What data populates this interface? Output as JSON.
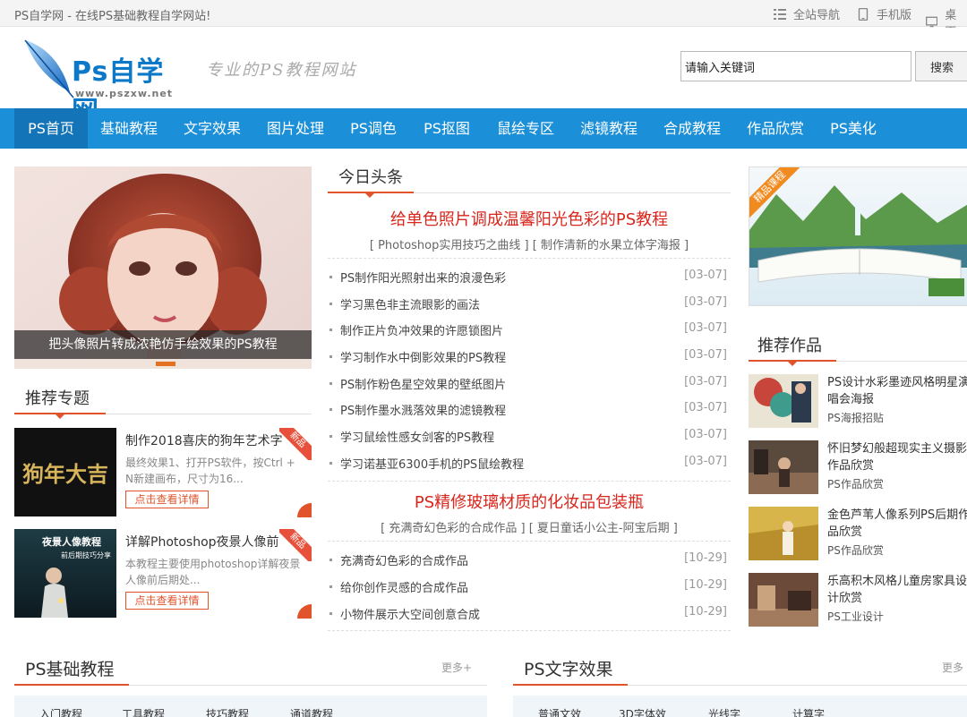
{
  "topbar": {
    "note": "PS自学网 - 在线PS基础教程自学网站!",
    "links": [
      {
        "label": "全站导航",
        "icon": "list-icon"
      },
      {
        "label": "手机版",
        "icon": "mobile-icon"
      },
      {
        "label": "桌面",
        "icon": "monitor-icon"
      }
    ]
  },
  "header": {
    "logo_title": "Ps自学网",
    "logo_url": "www.pszxw.net",
    "slogan": "专业的PS教程网站",
    "search_value": "请输入关键词",
    "search_button": "搜索"
  },
  "nav": {
    "items": [
      "PS首页",
      "基础教程",
      "文字效果",
      "图片处理",
      "PS调色",
      "PS抠图",
      "鼠绘专区",
      "滤镜教程",
      "合成教程",
      "作品欣赏",
      "PS美化"
    ],
    "active_index": 0
  },
  "slider": {
    "caption": "把头像照片转成浓艳仿手绘效果的PS教程"
  },
  "recommend_topics": {
    "title": "推荐专题",
    "items": [
      {
        "title": "制作2018喜庆的狗年艺术字",
        "desc": "最终效果1、打开PS软件，按Ctrl + N新建画布，尺寸为16...",
        "button": "点击查看详情",
        "ribbon": "新品",
        "thumb_text": "狗年大吉"
      },
      {
        "title": "详解Photoshop夜景人像前",
        "desc": "本教程主要使用photoshop详解夜景人像前后期处...",
        "button": "点击查看详情",
        "ribbon": "新品",
        "thumb_text": "夜景人像教程",
        "thumb_sub": "前后期技巧分享"
      }
    ]
  },
  "today_headlines": {
    "title": "今日头条",
    "groups": [
      {
        "headline": "给单色照片调成温馨阳光色彩的PS教程",
        "subline": "[ Photoshop实用技巧之曲线 ] [ 制作清新的水果立体字海报 ]",
        "items": [
          {
            "title": "PS制作阳光照射出来的浪漫色彩",
            "date": "[03-07]"
          },
          {
            "title": "学习黑色非主流眼影的画法",
            "date": "[03-07]"
          },
          {
            "title": "制作正片负冲效果的许愿锁图片",
            "date": "[03-07]"
          },
          {
            "title": "学习制作水中倒影效果的PS教程",
            "date": "[03-07]"
          },
          {
            "title": "PS制作粉色星空效果的壁纸图片",
            "date": "[03-07]"
          },
          {
            "title": "PS制作墨水溅落效果的滤镜教程",
            "date": "[03-07]"
          },
          {
            "title": "学习鼠绘性感女剑客的PS教程",
            "date": "[03-07]"
          },
          {
            "title": "学习诺基亚6300手机的PS鼠绘教程",
            "date": "[03-07]"
          }
        ]
      },
      {
        "headline": "PS精修玻璃材质的化妆品包装瓶",
        "subline": "[ 充满奇幻色彩的合成作品 ] [ 夏日童话小公主-阿宝后期 ]",
        "items": [
          {
            "title": "充满奇幻色彩的合成作品",
            "date": "[10-29]"
          },
          {
            "title": "给你创作灵感的合成作品",
            "date": "[10-29]"
          },
          {
            "title": "小物件展示大空间创意合成",
            "date": "[10-29]"
          }
        ]
      }
    ]
  },
  "promo": {
    "ribbon": "精品课程"
  },
  "recommend_works": {
    "title": "推荐作品",
    "items": [
      {
        "title": "PS设计水彩墨迹风格明星演唱会海报",
        "category": "PS海报招贴"
      },
      {
        "title": "怀旧梦幻般超现实主义摄影作品欣赏",
        "category": "PS作品欣赏"
      },
      {
        "title": "金色芦苇人像系列PS后期作品欣赏",
        "category": "PS作品欣赏"
      },
      {
        "title": "乐高积木风格儿童房家具设计欣赏",
        "category": "PS工业设计"
      }
    ]
  },
  "bottom_sections": [
    {
      "title": "PS基础教程",
      "more": "更多+",
      "tabs": [
        "入门教程",
        "工具教程",
        "技巧教程",
        "通道教程"
      ]
    },
    {
      "title": "PS文字效果",
      "more": "更多",
      "tabs": [
        "普通文效",
        "3D字体效",
        "光线字",
        "计算字"
      ]
    }
  ],
  "colors": {
    "nav_bg": "#1b8fd7",
    "nav_active": "#1474b8",
    "accent": "#e1542b",
    "headline_red": "#d9261c"
  }
}
